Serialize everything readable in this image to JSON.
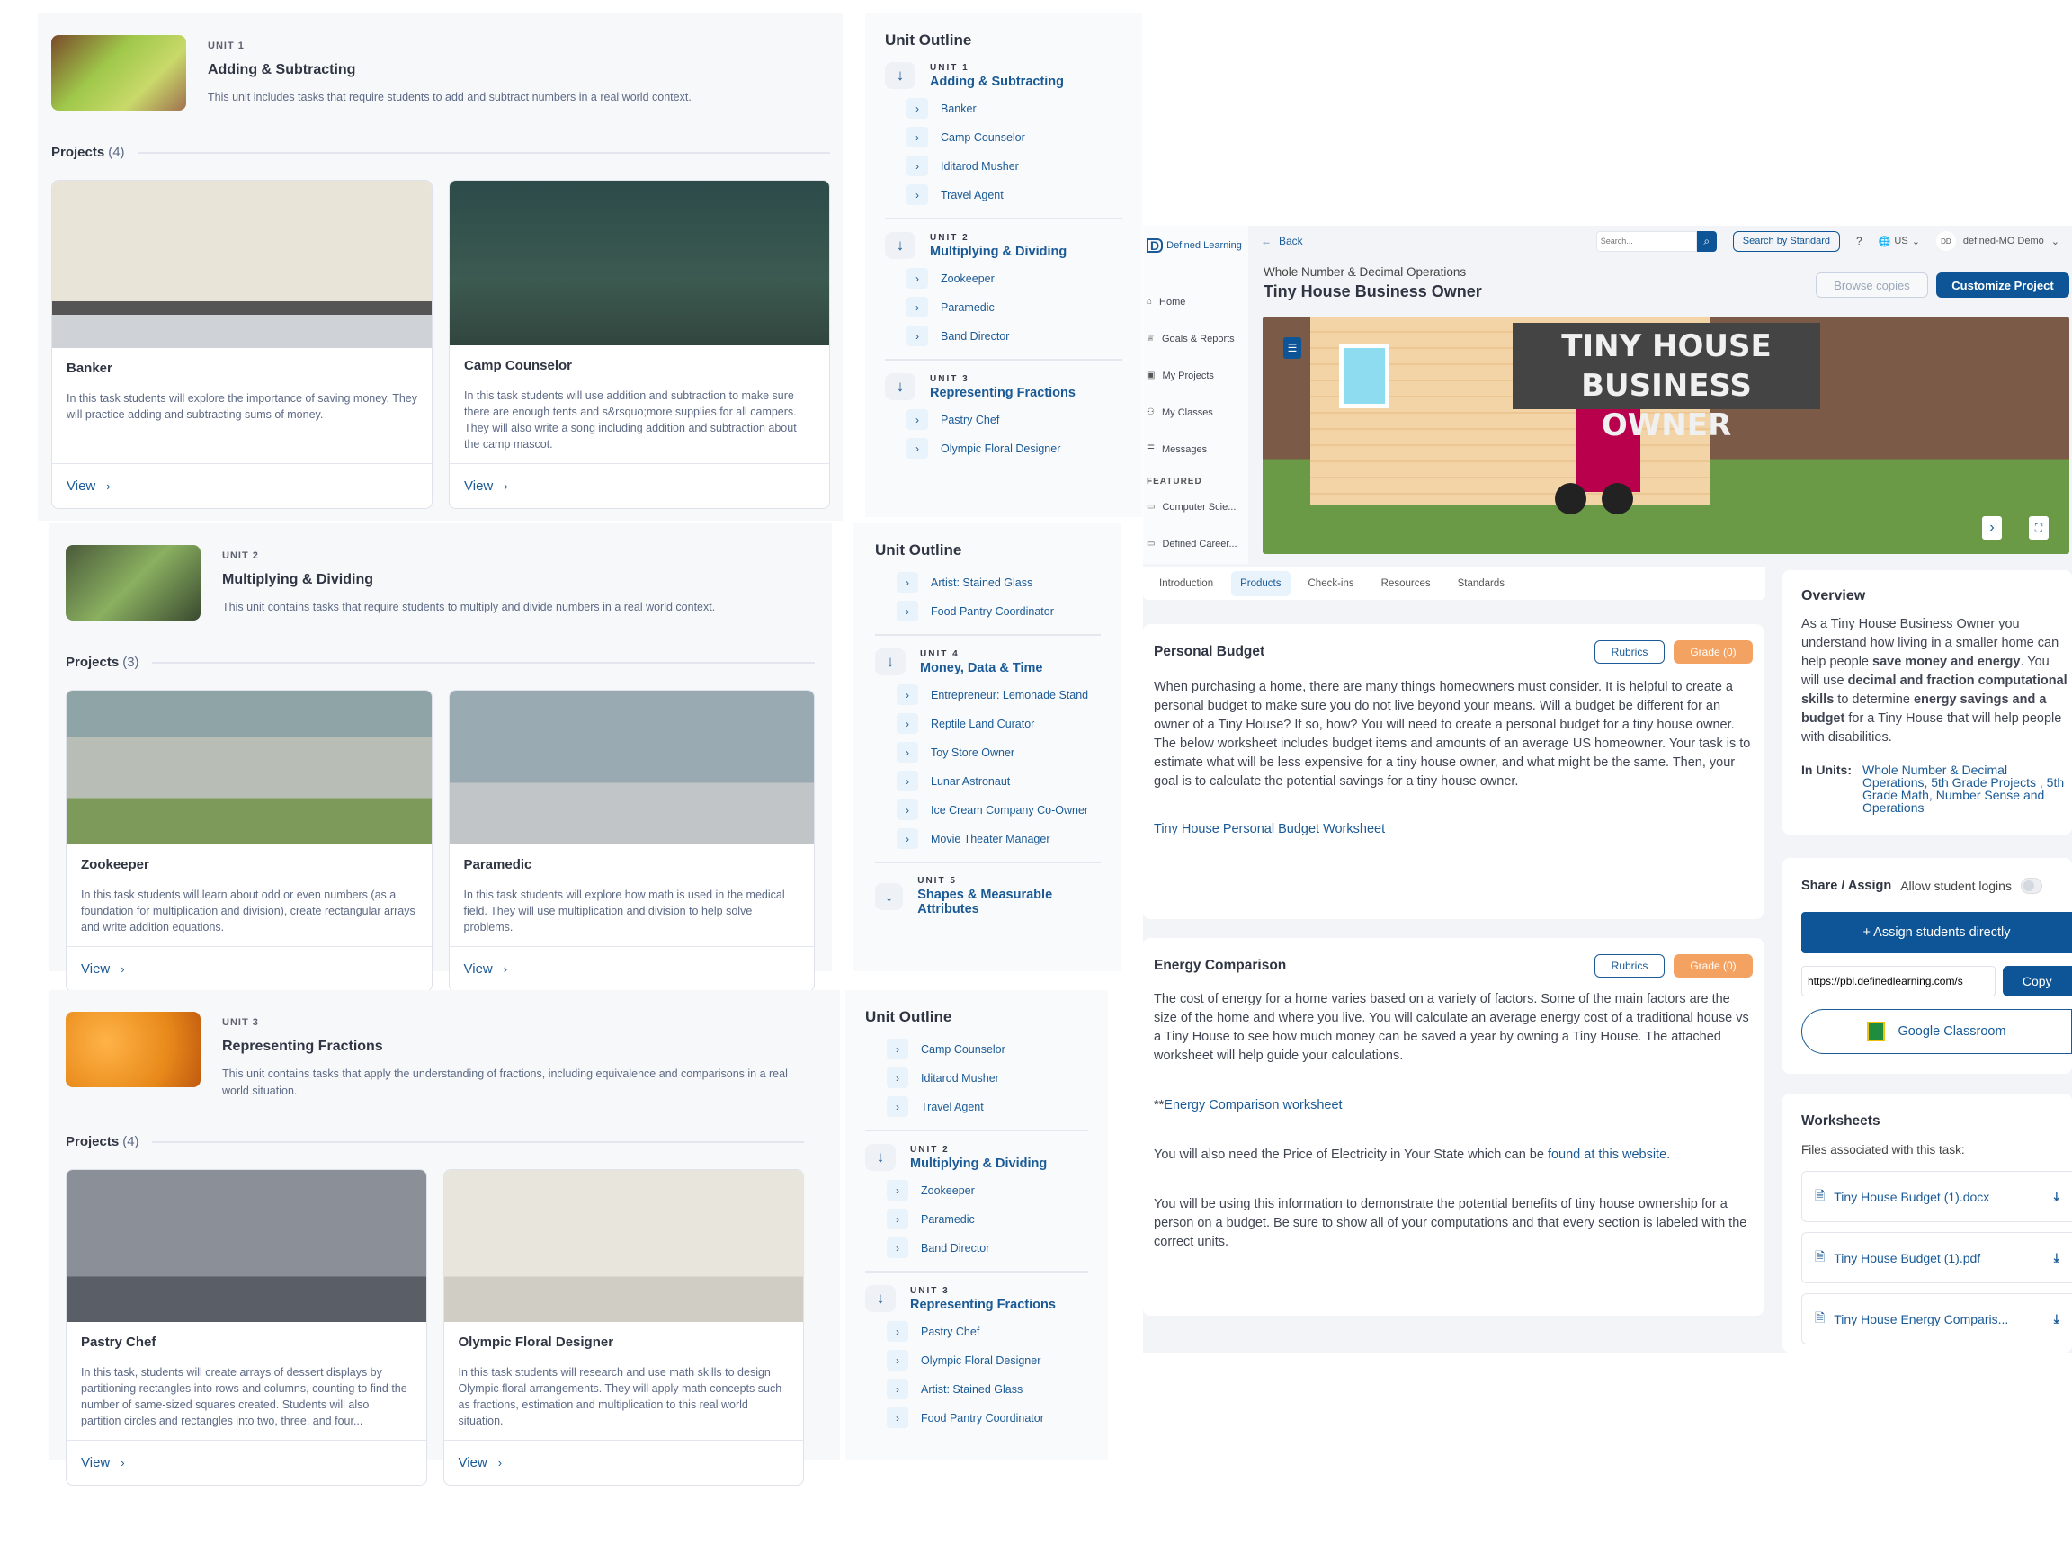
{
  "panels": [
    {
      "kicker": "UNIT 1",
      "name": "Adding & Subtracting",
      "desc": "This unit includes tasks that require students to add and subtract numbers in a real world context.",
      "projects_label": "Projects",
      "projects_count": "(4)",
      "cards": [
        {
          "title": "Banker",
          "desc": "In this task students will explore the importance of saving money. They will practice adding and subtracting sums of money.",
          "view": "View"
        },
        {
          "title": "Camp Counselor",
          "desc": "In this task students will use addition and subtraction to make sure there are enough tents and s&rsquo;more supplies for all campers. They will also write a song including addition and subtraction about the camp mascot.",
          "view": "View"
        }
      ]
    },
    {
      "kicker": "UNIT 2",
      "name": "Multiplying & Dividing",
      "desc": "This unit contains tasks that require students to multiply and divide numbers in a real world context.",
      "projects_label": "Projects",
      "projects_count": "(3)",
      "cards": [
        {
          "title": "Zookeeper",
          "desc": "In this task students will learn about odd or even numbers (as a foundation for multiplication and division), create rectangular arrays and write addition equations.",
          "view": "View"
        },
        {
          "title": "Paramedic",
          "desc": "In this task students will explore how math is used in the medical field. They will use multiplication and division to help solve problems.",
          "view": "View"
        }
      ]
    },
    {
      "kicker": "UNIT 3",
      "name": "Representing Fractions",
      "desc": "This unit contains tasks that apply the understanding of fractions, including equivalence and comparisons in a real world situation.",
      "projects_label": "Projects",
      "projects_count": "(4)",
      "cards": [
        {
          "title": "Pastry Chef",
          "desc": "In this task, students will create arrays of dessert displays by partitioning rectangles into rows and columns, counting to find the number of same-sized squares created. Students will also partition circles and rectangles into two, three, and four...",
          "view": "View"
        },
        {
          "title": "Olympic Floral Designer",
          "desc": "In this task students will research and use math skills to design Olympic floral arrangements. They will apply math concepts such as fractions, estimation and multiplication to this real world situation.",
          "view": "View"
        }
      ]
    }
  ],
  "outlines": [
    {
      "title": "Unit Outline",
      "blocks": [
        {
          "kicker": "UNIT 1",
          "name": "Adding & Subtracting",
          "items": [
            "Banker",
            "Camp Counselor",
            "Iditarod Musher",
            "Travel Agent"
          ]
        },
        {
          "kicker": "UNIT 2",
          "name": "Multiplying & Dividing",
          "items": [
            "Zookeeper",
            "Paramedic",
            "Band Director"
          ]
        },
        {
          "kicker": "UNIT 3",
          "name": "Representing Fractions",
          "items": [
            "Pastry Chef",
            "Olympic Floral Designer"
          ]
        }
      ]
    },
    {
      "title": "Unit Outline",
      "blocks": [
        {
          "kicker": "",
          "name": "",
          "items": [
            "Artist: Stained Glass",
            "Food Pantry Coordinator"
          ]
        },
        {
          "kicker": "UNIT 4",
          "name": "Money, Data & Time",
          "items": [
            "Entrepreneur: Lemonade Stand",
            "Reptile Land Curator",
            "Toy Store Owner",
            "Lunar Astronaut",
            "Ice Cream Company Co-Owner",
            "Movie Theater Manager"
          ]
        },
        {
          "kicker": "UNIT 5",
          "name": "Shapes & Measurable Attributes",
          "items": []
        }
      ]
    },
    {
      "title": "Unit Outline",
      "blocks": [
        {
          "kicker": "",
          "name": "",
          "items": [
            "Camp Counselor",
            "Iditarod Musher",
            "Travel Agent"
          ]
        },
        {
          "kicker": "UNIT 2",
          "name": "Multiplying & Dividing",
          "items": [
            "Zookeeper",
            "Paramedic",
            "Band Director"
          ]
        },
        {
          "kicker": "UNIT 3",
          "name": "Representing Fractions",
          "items": [
            "Pastry Chef",
            "Olympic Floral Designer",
            "Artist: Stained Glass",
            "Food Pantry Coordinator"
          ]
        }
      ]
    }
  ],
  "app": {
    "logo": "Defined Learning",
    "sidebar": [
      {
        "label": "Home",
        "icon": "home-icon"
      },
      {
        "label": "Goals & Reports",
        "icon": "trophy-icon"
      },
      {
        "label": "My Projects",
        "icon": "projects-icon"
      },
      {
        "label": "My Classes",
        "icon": "classes-icon"
      },
      {
        "label": "Messages",
        "icon": "messages-icon"
      }
    ],
    "featured_label": "FEATURED",
    "featured": [
      {
        "label": "Computer Scie...",
        "icon": "book-icon"
      },
      {
        "label": "Defined Career...",
        "icon": "book-icon"
      }
    ],
    "topbar": {
      "back": "Back",
      "search_placeholder": "Search...",
      "search_by_standard": "Search by Standard",
      "help": "?",
      "region": "US",
      "avatar": "DD",
      "user": "defined-MO Demo"
    },
    "breadcrumb": "Whole Number & Decimal Operations",
    "title": "Tiny House Business Owner",
    "browse_copies": "Browse copies",
    "customize": "Customize Project",
    "hero_title_line1": "TINY HOUSE",
    "hero_title_line2": "BUSINESS OWNER",
    "tabs": [
      "Introduction",
      "Products",
      "Check-ins",
      "Resources",
      "Standards"
    ],
    "active_tab": "Products",
    "products": [
      {
        "title": "Personal Budget",
        "rubrics": "Rubrics",
        "grade": "Grade (0)",
        "paras": [
          "When purchasing a home, there are many things homeowners must consider. It is helpful to create a personal budget to make sure you do not live beyond your means. Will a budget be different for an owner of a Tiny House? If so, how? You will need to create a personal budget for a tiny house owner. The below worksheet includes budget items and amounts of an average US homeowner. Your task is to estimate what will be less expensive for a tiny house owner, and what might be the same. Then, your goal is to calculate the potential savings for a tiny house owner."
        ],
        "link": "Tiny House Personal Budget Worksheet"
      },
      {
        "title": "Energy Comparison",
        "rubrics": "Rubrics",
        "grade": "Grade (0)",
        "p1": "The cost of energy for a home varies based on a variety of factors. Some of the main factors are the size of the home and where you live. You will calculate an average energy cost of a traditional house vs a Tiny House to see how much money can be saved a year by owning a Tiny House. The attached worksheet will help guide your calculations.",
        "link_prefix": "**",
        "link": "Energy Comparison worksheet",
        "p2": "You will also need the Price of Electricity in Your State which can be ",
        "p2_link": "found at this website.",
        "p3": "You will be using this information to demonstrate the potential benefits of tiny house ownership for a person on a budget. Be sure to show all of your computations and that every section is labeled with the correct units."
      }
    ],
    "overview": {
      "title": "Overview",
      "t1": "As a Tiny House Business Owner you understand how living in a smaller home can help people ",
      "b1": "save money and energy",
      "t2": ". You will use ",
      "b2": "decimal and fraction computational skills",
      "t3": " to determine ",
      "b3": "energy savings and a budget",
      "t4": " for a Tiny House that will help people with disabilities.",
      "in_units_label": "In Units:",
      "in_units": "Whole Number & Decimal Operations, 5th Grade Projects , 5th Grade Math, Number Sense and Operations"
    },
    "share": {
      "title": "Share / Assign",
      "allow_logins": "Allow student logins",
      "allow_logins_on": false,
      "assign": "+  Assign students directly",
      "url": "https://pbl.definedlearning.com/s",
      "copy": "Copy",
      "google": "Google Classroom"
    },
    "worksheets": {
      "title": "Worksheets",
      "subtitle": "Files associated with this task:",
      "files": [
        "Tiny House Budget (1).docx",
        "Tiny House Budget (1).pdf",
        "Tiny House Energy Comparis..."
      ]
    },
    "colors": {
      "primary": "#0d5596",
      "accent_orange": "#f4a261",
      "link": "#1a5a96"
    }
  }
}
